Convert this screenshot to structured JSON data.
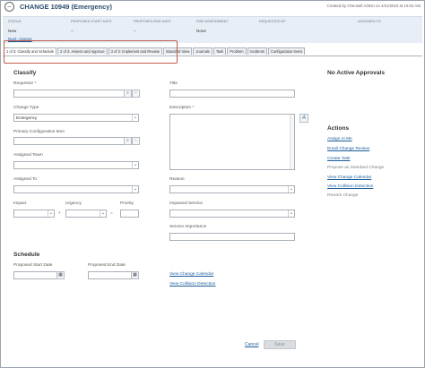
{
  "header": {
    "title": "CHANGE 10949 (Emergency)",
    "created_by": "Created by Cherwell Admin on 4/11/2019 at 10:02 AM"
  },
  "status_band": {
    "status_label": "STATUS",
    "status_value": "New",
    "next_link": "Next: Assess",
    "proposed_start_label": "PROPOSED START DATE",
    "proposed_start_value": "--",
    "proposed_end_label": "PROPOSED END DATE",
    "proposed_end_value": "--",
    "risk_label": "RISK ASSESSMENT",
    "risk_value": "None",
    "requested_by_label": "REQUESTED BY",
    "assigned_to_label": "ASSIGNED TO"
  },
  "tabs": [
    {
      "label": "1 of 3: Classify and Schedule",
      "active": true
    },
    {
      "label": "2 of 3: Assess and Approve",
      "active": false
    },
    {
      "label": "3 of 3: Implement and Review",
      "active": false
    },
    {
      "label": "Standard View",
      "active": false
    },
    {
      "label": "Journals",
      "active": false
    },
    {
      "label": "Task",
      "active": false
    },
    {
      "label": "Problem",
      "active": false
    },
    {
      "label": "Incidents",
      "active": false
    },
    {
      "label": "Configuration Items",
      "active": false
    }
  ],
  "classify": {
    "section_title": "Classify",
    "requestor_label": "Requestor",
    "required_mark": "*",
    "change_type_label": "Change Type",
    "change_type_value": "Emergency",
    "primary_ci_label": "Primary Configuration Item",
    "assigned_team_label": "Assigned Team",
    "assigned_to_label": "Assigned To",
    "impact_label": "Impact",
    "urgency_label": "Urgency",
    "priority_label": "Priority",
    "times_symbol": "×",
    "equals_symbol": "=",
    "title_label": "Title",
    "description_label": "Description",
    "reason_label": "Reason",
    "impacted_service_label": "Impacted Service",
    "service_importance_label": "Service Importance"
  },
  "schedule": {
    "section_title": "Schedule",
    "proposed_start_label": "Proposed Start Date",
    "proposed_end_label": "Proposed End Date",
    "view_calendar_link": "View Change Calendar",
    "view_collision_link": "View Collision Detection"
  },
  "approvals": {
    "title": "No Active Approvals"
  },
  "actions": {
    "title": "Actions",
    "items": [
      {
        "label": "Assign to Me",
        "type": "link"
      },
      {
        "label": "Email Change Review",
        "type": "link"
      },
      {
        "label": "Create Task",
        "type": "link"
      },
      {
        "label": "Propose as Standard Change",
        "type": "disabled"
      },
      {
        "label": "View Change Calendar",
        "type": "link"
      },
      {
        "label": "View Collision Detection",
        "type": "link"
      },
      {
        "label": "Rework Change",
        "type": "disabled"
      }
    ]
  },
  "footer": {
    "cancel_label": "Cancel",
    "save_label": "Save"
  },
  "icons": {
    "header": "minus-circle-icon",
    "search": "search-icon",
    "lookup": "lookup-icon",
    "calendar": "calendar-icon",
    "spellcheck": "spellcheck-icon",
    "dropdown": "chevron-down-icon"
  },
  "colors": {
    "title": "#2a4d6e",
    "link": "#1b5d9a",
    "band": "#e8eef5",
    "highlight": "#c05a4a",
    "required": "#c0392b"
  }
}
